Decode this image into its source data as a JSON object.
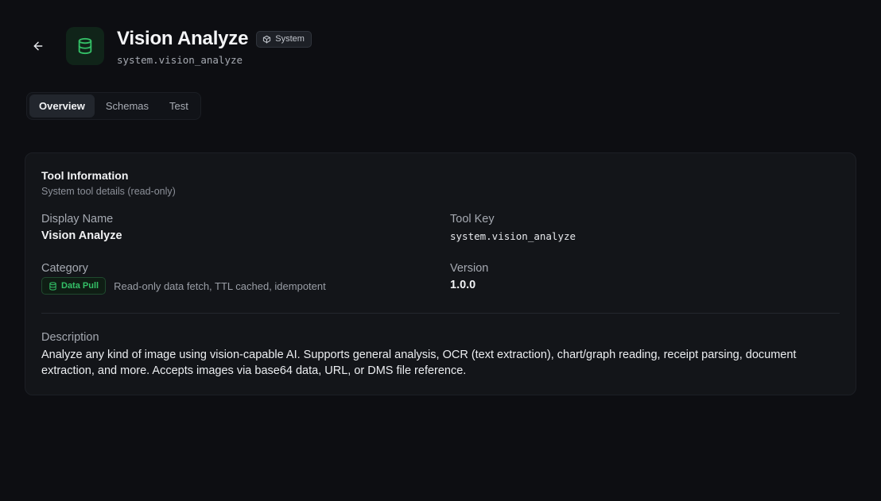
{
  "header": {
    "title": "Vision Analyze",
    "badge_label": "System",
    "tool_key": "system.vision_analyze"
  },
  "tabs": [
    {
      "label": "Overview",
      "active": true
    },
    {
      "label": "Schemas",
      "active": false
    },
    {
      "label": "Test",
      "active": false
    }
  ],
  "card": {
    "title": "Tool Information",
    "subtitle": "System tool details (read-only)",
    "display_name_label": "Display Name",
    "display_name_value": "Vision Analyze",
    "tool_key_label": "Tool Key",
    "tool_key_value": "system.vision_analyze",
    "category_label": "Category",
    "category_badge": "Data Pull",
    "category_desc": "Read-only data fetch, TTL cached, idempotent",
    "version_label": "Version",
    "version_value": "1.0.0",
    "description_label": "Description",
    "description_value": "Analyze any kind of image using vision-capable AI. Supports general analysis, OCR (text extraction), chart/graph reading, receipt parsing, document extraction, and more. Accepts images via base64 data, URL, or DMS file reference."
  },
  "icons": {
    "back": "arrow-left-icon",
    "tool": "database-icon",
    "badge": "cube-icon",
    "category": "database-icon"
  },
  "colors": {
    "accent_green": "#34c067",
    "background": "#0d0e12",
    "card": "#131519"
  }
}
